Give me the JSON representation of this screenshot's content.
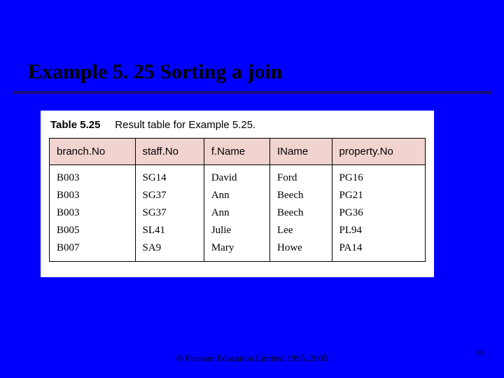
{
  "title": "Example 5. 25  Sorting a join",
  "caption": {
    "label": "Table 5.25",
    "text": "Result table for Example 5.25."
  },
  "table": {
    "headers": [
      "branch.No",
      "staff.No",
      "f.Name",
      "IName",
      "property.No"
    ],
    "rows": [
      [
        "B003",
        "SG14",
        "David",
        "Ford",
        "PG16"
      ],
      [
        "B003",
        "SG37",
        "Ann",
        "Beech",
        "PG21"
      ],
      [
        "B003",
        "SG37",
        "Ann",
        "Beech",
        "PG36"
      ],
      [
        "B005",
        "SL41",
        "Julie",
        "Lee",
        "PL94"
      ],
      [
        "B007",
        "SA9",
        "Mary",
        "Howe",
        "PA14"
      ]
    ]
  },
  "footer": "© Pearson Education Limited 1995, 2005",
  "page": "83",
  "chart_data": {
    "type": "table",
    "title": "Table 5.25 Result table for Example 5.25.",
    "headers": [
      "branch.No",
      "staff.No",
      "f.Name",
      "IName",
      "property.No"
    ],
    "rows": [
      [
        "B003",
        "SG14",
        "David",
        "Ford",
        "PG16"
      ],
      [
        "B003",
        "SG37",
        "Ann",
        "Beech",
        "PG21"
      ],
      [
        "B003",
        "SG37",
        "Ann",
        "Beech",
        "PG36"
      ],
      [
        "B005",
        "SL41",
        "Julie",
        "Lee",
        "PL94"
      ],
      [
        "B007",
        "SA9",
        "Mary",
        "Howe",
        "PA14"
      ]
    ]
  }
}
